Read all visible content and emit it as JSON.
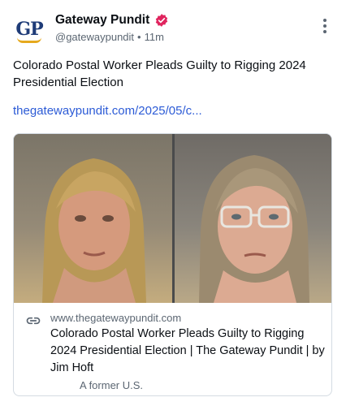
{
  "account": {
    "display_name": "Gateway Pundit",
    "handle": "@gatewaypundit",
    "separator": "•",
    "time": "11m",
    "avatar_text": "GP",
    "verified_icon": "verified-badge-icon",
    "verified_color": "#e0245e"
  },
  "post": {
    "text": "Colorado Postal Worker Pleads Guilty to Rigging 2024 Presidential Election",
    "link": "thegatewaypundit.com/2025/05/c..."
  },
  "card": {
    "domain": "www.thegatewaypundit.com",
    "title": "Colorado Postal Worker Pleads Guilty to Rigging 2024 Presidential Election | The Gateway Pundit | by Jim Hoft",
    "description": "A former U.S."
  },
  "colors": {
    "link": "#2c5bd6",
    "muted": "#5b6672",
    "brand_blue": "#1f3c78",
    "brand_gold": "#e6a91e"
  }
}
